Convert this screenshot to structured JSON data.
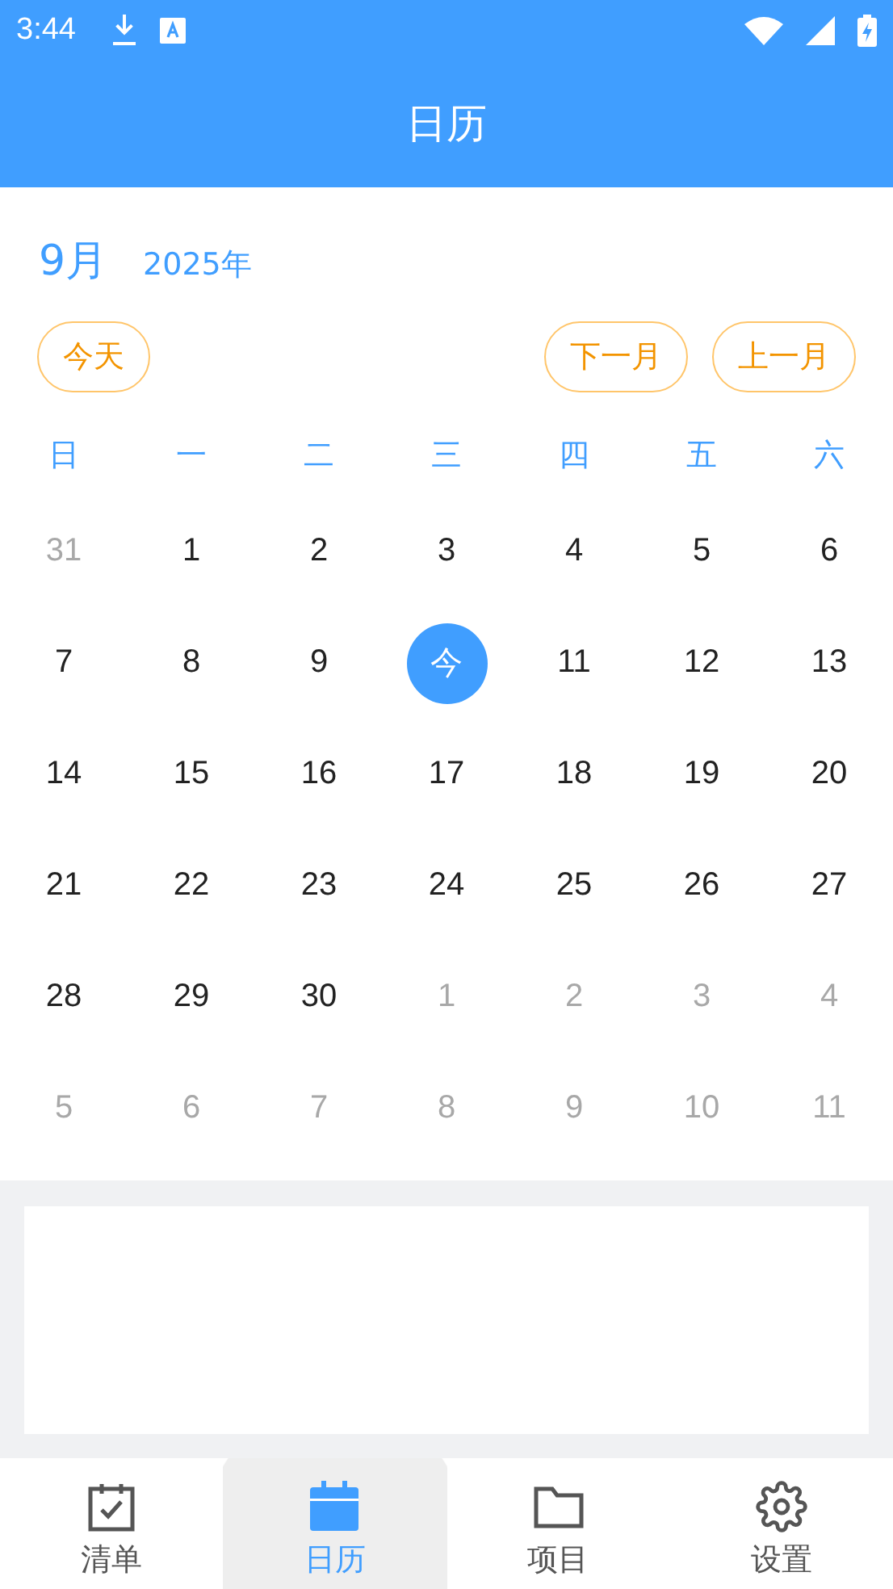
{
  "status_bar": {
    "time": "3:44"
  },
  "app_bar": {
    "title": "日历"
  },
  "header": {
    "month": "9月",
    "year": "2025年"
  },
  "buttons": [
    {
      "label": "今天",
      "kind": "today"
    },
    {
      "label": "下一月",
      "kind": "next"
    },
    {
      "label": "上一月",
      "kind": "prev"
    }
  ],
  "weekdays": [
    "日",
    "一",
    "二",
    "三",
    "四",
    "五",
    "六"
  ],
  "weeks": [
    [
      {
        "label": "31",
        "in_month": false,
        "selected": false
      },
      {
        "label": "1",
        "in_month": true,
        "selected": false
      },
      {
        "label": "2",
        "in_month": true,
        "selected": false
      },
      {
        "label": "3",
        "in_month": true,
        "selected": false
      },
      {
        "label": "4",
        "in_month": true,
        "selected": false
      },
      {
        "label": "5",
        "in_month": true,
        "selected": false
      },
      {
        "label": "6",
        "in_month": true,
        "selected": false
      }
    ],
    [
      {
        "label": "7",
        "in_month": true,
        "selected": false
      },
      {
        "label": "8",
        "in_month": true,
        "selected": false
      },
      {
        "label": "9",
        "in_month": true,
        "selected": false
      },
      {
        "label": "今",
        "in_month": true,
        "selected": true
      },
      {
        "label": "11",
        "in_month": true,
        "selected": false
      },
      {
        "label": "12",
        "in_month": true,
        "selected": false
      },
      {
        "label": "13",
        "in_month": true,
        "selected": false
      }
    ],
    [
      {
        "label": "14",
        "in_month": true,
        "selected": false
      },
      {
        "label": "15",
        "in_month": true,
        "selected": false
      },
      {
        "label": "16",
        "in_month": true,
        "selected": false
      },
      {
        "label": "17",
        "in_month": true,
        "selected": false
      },
      {
        "label": "18",
        "in_month": true,
        "selected": false
      },
      {
        "label": "19",
        "in_month": true,
        "selected": false
      },
      {
        "label": "20",
        "in_month": true,
        "selected": false
      }
    ],
    [
      {
        "label": "21",
        "in_month": true,
        "selected": false
      },
      {
        "label": "22",
        "in_month": true,
        "selected": false
      },
      {
        "label": "23",
        "in_month": true,
        "selected": false
      },
      {
        "label": "24",
        "in_month": true,
        "selected": false
      },
      {
        "label": "25",
        "in_month": true,
        "selected": false
      },
      {
        "label": "26",
        "in_month": true,
        "selected": false
      },
      {
        "label": "27",
        "in_month": true,
        "selected": false
      }
    ],
    [
      {
        "label": "28",
        "in_month": true,
        "selected": false
      },
      {
        "label": "29",
        "in_month": true,
        "selected": false
      },
      {
        "label": "30",
        "in_month": true,
        "selected": false
      },
      {
        "label": "1",
        "in_month": false,
        "selected": false
      },
      {
        "label": "2",
        "in_month": false,
        "selected": false
      },
      {
        "label": "3",
        "in_month": false,
        "selected": false
      },
      {
        "label": "4",
        "in_month": false,
        "selected": false
      }
    ],
    [
      {
        "label": "5",
        "in_month": false,
        "selected": false
      },
      {
        "label": "6",
        "in_month": false,
        "selected": false
      },
      {
        "label": "7",
        "in_month": false,
        "selected": false
      },
      {
        "label": "8",
        "in_month": false,
        "selected": false
      },
      {
        "label": "9",
        "in_month": false,
        "selected": false
      },
      {
        "label": "10",
        "in_month": false,
        "selected": false
      },
      {
        "label": "11",
        "in_month": false,
        "selected": false
      }
    ]
  ],
  "nav": [
    {
      "label": "清单",
      "kind": "checklist",
      "selected": false
    },
    {
      "label": "日历",
      "kind": "calendar",
      "selected": true
    },
    {
      "label": "项目",
      "kind": "folder",
      "selected": false
    },
    {
      "label": "设置",
      "kind": "settings",
      "selected": false
    }
  ]
}
